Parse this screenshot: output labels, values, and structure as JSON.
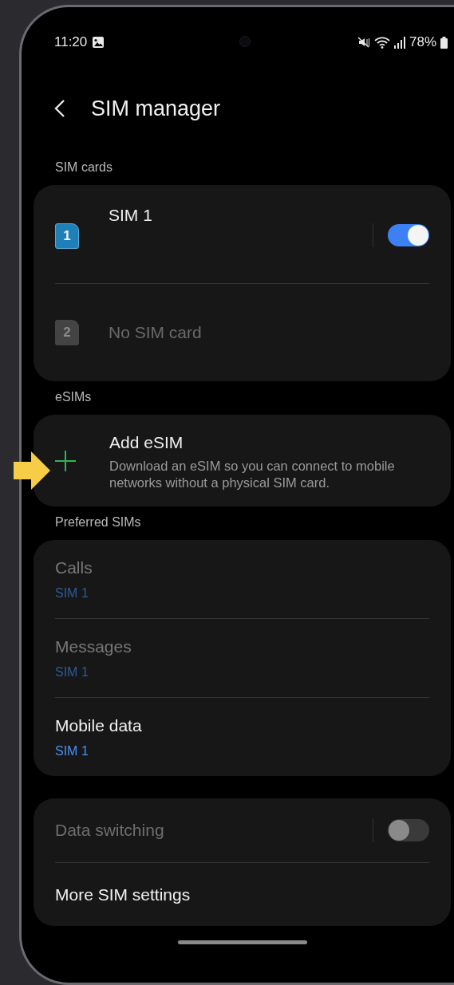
{
  "status_bar": {
    "time": "11:20",
    "battery": "78%"
  },
  "header": {
    "title": "SIM manager"
  },
  "sections": [
    {
      "title": "SIM cards",
      "items": [
        {
          "kind": "sim",
          "slot": "1",
          "label": "SIM 1",
          "disabled": false,
          "on": true
        },
        {
          "kind": "sim",
          "slot": "2",
          "label": "No SIM card",
          "disabled": true
        }
      ]
    },
    {
      "title": "eSIMs",
      "items": [
        {
          "kind": "add",
          "title": "Add eSIM",
          "subtitle": "Download an eSIM so you can connect to mobile networks without a physical SIM card."
        }
      ]
    },
    {
      "title": "Preferred SIMs",
      "items": [
        {
          "kind": "pref",
          "title": "Calls",
          "value": "SIM 1",
          "disabled": true
        },
        {
          "kind": "pref",
          "title": "Messages",
          "value": "SIM 1",
          "disabled": true
        },
        {
          "kind": "pref",
          "title": "Mobile data",
          "value": "SIM 1",
          "disabled": false
        }
      ]
    },
    {
      "items": [
        {
          "kind": "switch",
          "title": "Data switching",
          "disabled": true,
          "on": false
        },
        {
          "kind": "link",
          "title": "More SIM settings",
          "disabled": false
        }
      ]
    }
  ]
}
